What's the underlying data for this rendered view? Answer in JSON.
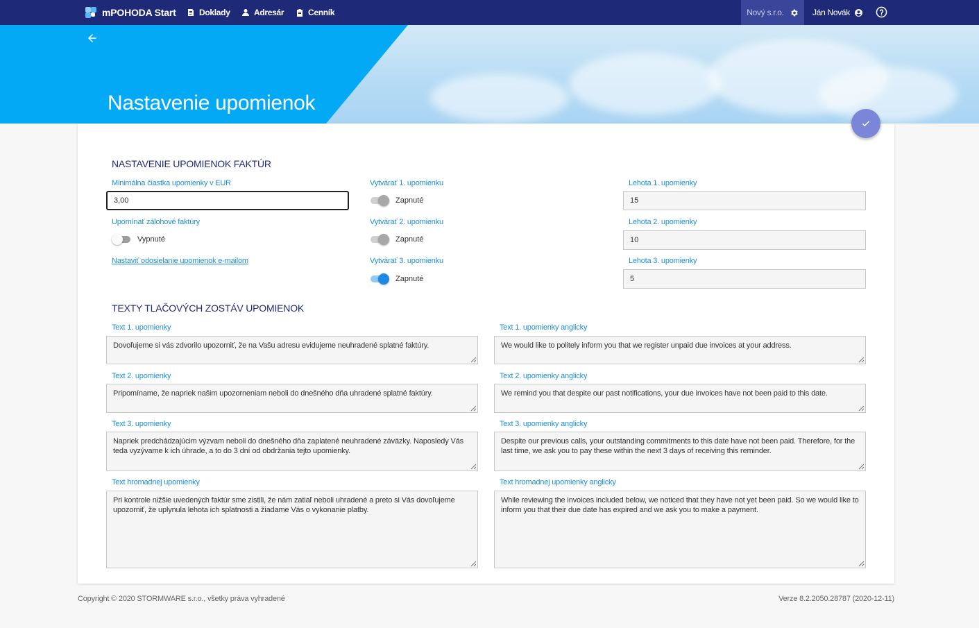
{
  "app": {
    "name": "mPOHODA Start"
  },
  "nav": {
    "doklady": "Doklady",
    "adresar": "Adresár",
    "cennik": "Cenník",
    "company": "Nový s.r.o.",
    "user": "Ján Novák"
  },
  "page": {
    "title": "Nastavenie upomienok"
  },
  "settings": {
    "section_title": "NASTAVENIE UPOMIENOK FAKTÚR",
    "min_amount_label": "Minimálna čiastka upomienky v EUR",
    "min_amount_value": "3,00",
    "advance_label": "Upomínať zálohové faktúry",
    "advance_state": "Vypnuté",
    "email_link": "Nastaviť odosielanie upomienok e-mailom",
    "create1_label": "Vytvárať 1. upomienku",
    "create1_state": "Zapnuté",
    "create2_label": "Vytvárať 2. upomienku",
    "create2_state": "Zapnuté",
    "create3_label": "Vytvárať 3. upomienku",
    "create3_state": "Zapnuté",
    "due1_label": "Lehota 1. upomienky",
    "due1_value": "15",
    "due2_label": "Lehota 2. upomienky",
    "due2_value": "10",
    "due3_label": "Lehota 3. upomienky",
    "due3_value": "5"
  },
  "texts": {
    "section_title": "TEXTY TLAČOVÝCH ZOSTÁV UPOMIENOK",
    "t1_label": "Text 1. upomienky",
    "t1_value": "Dovoľujeme si vás zdvorilo upozorniť, že na Vašu adresu evidujeme neuhradené splatné faktúry.",
    "t1en_label": "Text 1. upomienky anglicky",
    "t1en_value": "We would like to politely inform you that we register unpaid due invoices at your address.",
    "t2_label": "Text 2. upomienky",
    "t2_value": "Pripomíname, že napriek našim upozorneniam neboli do dnešného dňa uhradené splatné faktúry.",
    "t2en_label": "Text 2. upomienky anglicky",
    "t2en_value": "We remind you that despite our past notifications, your due invoices have not been paid to this date.",
    "t3_label": "Text 3. upomienky",
    "t3_value": "Napriek predchádzajúcim výzvam neboli do dnešného dňa zaplatené neuhradené záväzky. Naposledy Vás teda vyzývame k ich úhrade, a to do 3 dní od obdržania tejto upomienky.",
    "t3en_label": "Text 3. upomienky anglicky",
    "t3en_value": "Despite our previous calls, your outstanding commitments to this date have not been paid. Therefore, for the last time, we ask you to pay these within the next 3 days of receiving this reminder.",
    "bulk_label": "Text hromadnej upomienky",
    "bulk_value": "Pri kontrole nižšie uvedených faktúr sme zistili, že nám zatiaľ neboli uhradené a preto si Vás dovoľujeme upozorniť, že uplynula lehota ich splatnosti a žiadame Vás o vykonanie platby.",
    "bulken_label": "Text hromadnej upomienky anglicky",
    "bulken_value": "While reviewing the invoices included below, we noticed that they have not yet been paid. So we would like to inform you that their due date has expired and we ask you to make a payment."
  },
  "footer": {
    "copyright": "Copyright © 2020 STORMWARE s.r.o., všetky práva vyhradené",
    "version": "Verze 8.2.2050.28787 (2020-12-11)"
  },
  "colors": {
    "navbar": "#1e2a78",
    "hero_blue": "#03a9f4",
    "accent": "#1d8fd8",
    "fab": "#7a86d8"
  }
}
